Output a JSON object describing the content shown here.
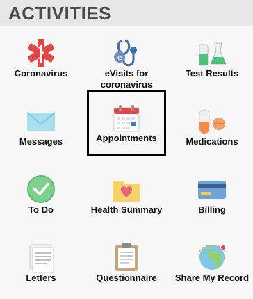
{
  "header": {
    "title": "ACTIVITIES"
  },
  "tiles": [
    {
      "label": "Coronavirus",
      "icon": "medical-star-icon"
    },
    {
      "label": "eVisits for coronavirus",
      "icon": "stethoscope-icon"
    },
    {
      "label": "Test Results",
      "icon": "lab-flasks-icon"
    },
    {
      "label": "Messages",
      "icon": "envelope-icon"
    },
    {
      "label": "Appointments",
      "icon": "calendar-icon"
    },
    {
      "label": "Medications",
      "icon": "pills-icon"
    },
    {
      "label": "To Do",
      "icon": "checkmark-circle-icon"
    },
    {
      "label": "Health Summary",
      "icon": "heart-folder-icon"
    },
    {
      "label": "Billing",
      "icon": "credit-card-icon"
    },
    {
      "label": "Letters",
      "icon": "letters-icon"
    },
    {
      "label": "Questionnaire",
      "icon": "clipboard-icon"
    },
    {
      "label": "Share My Record",
      "icon": "globe-share-icon"
    }
  ],
  "colors": {
    "accent": "#e04848",
    "header_bg": "#e6e6e6"
  }
}
